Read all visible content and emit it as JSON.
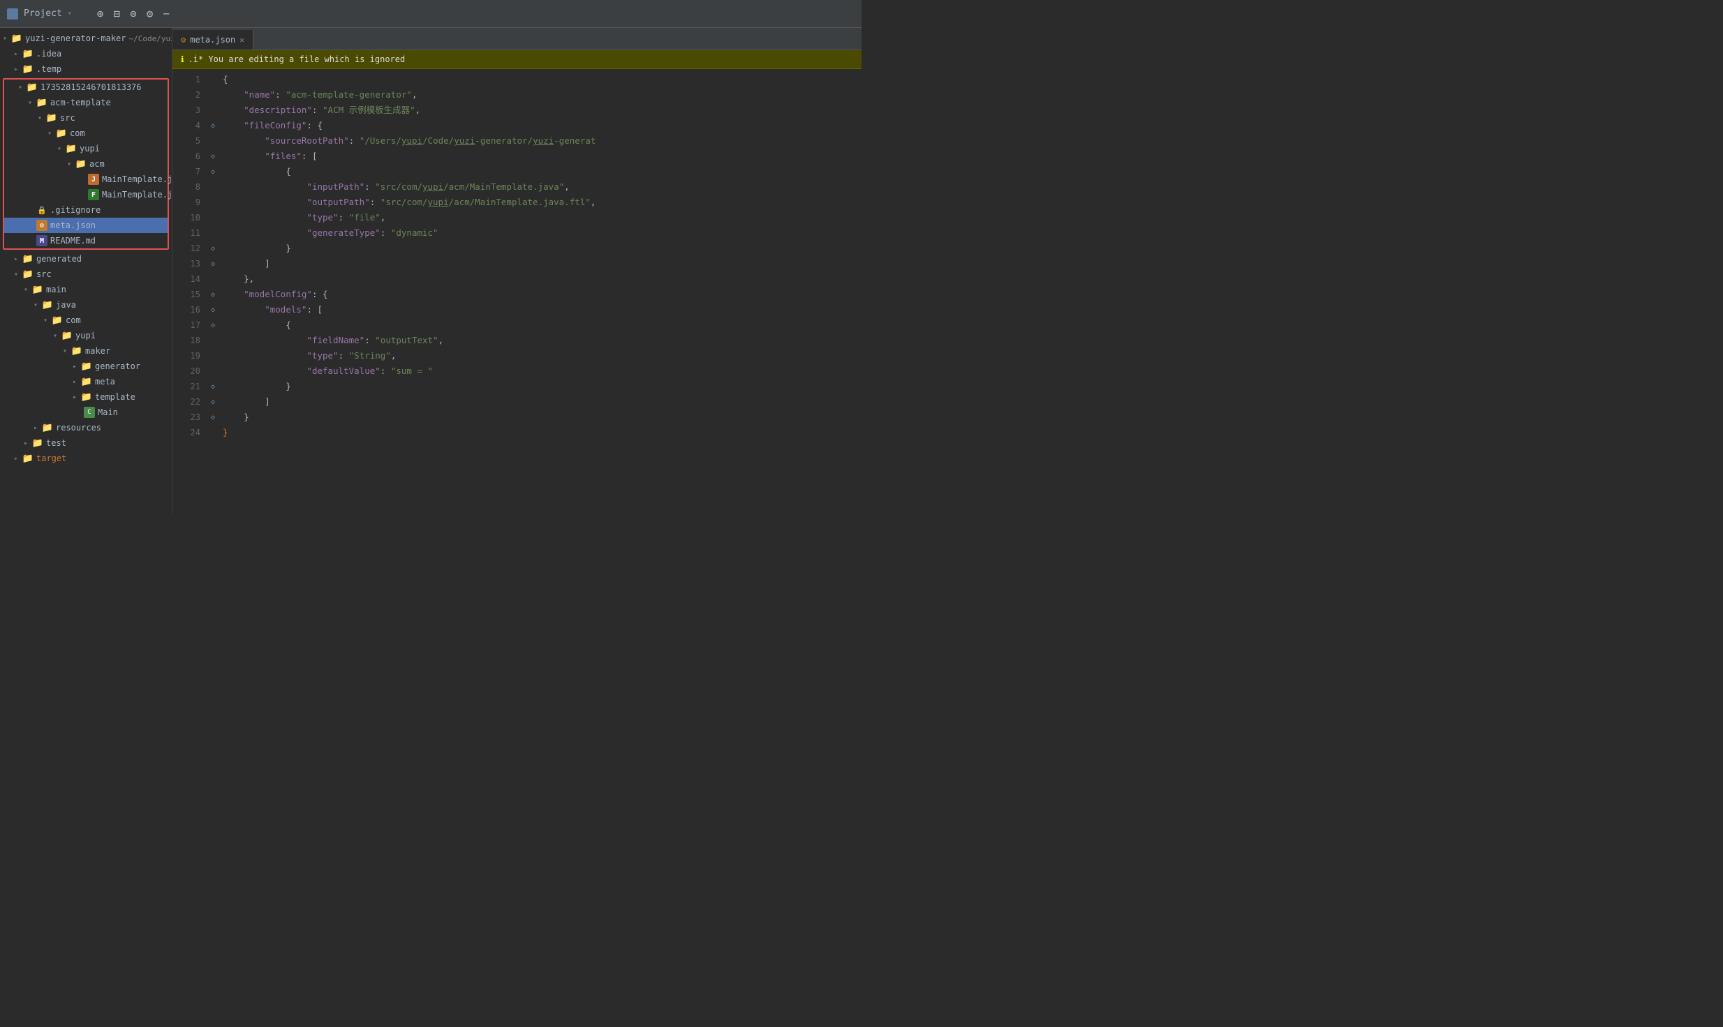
{
  "titleBar": {
    "title": "Project",
    "projectName": "yuzi-generator-maker",
    "projectPath": "~/Code/yuzi-generator/y",
    "icons": [
      "target-icon",
      "layout-icon",
      "filter-icon",
      "settings-icon",
      "minimize-icon"
    ]
  },
  "tabs": [
    {
      "label": "meta.json",
      "active": true,
      "icon": "json-icon"
    }
  ],
  "warningBar": {
    "text": ".i* You are editing a file which is ignored"
  },
  "sidebar": {
    "items": [
      {
        "id": "idea",
        "label": ".idea",
        "type": "folder",
        "depth": 1,
        "open": false,
        "color": "blue"
      },
      {
        "id": "temp",
        "label": ".temp",
        "type": "folder",
        "depth": 1,
        "open": false,
        "color": "gray"
      },
      {
        "id": "temp-id",
        "label": "17352815246701813376",
        "type": "folder",
        "depth": 1,
        "open": true,
        "color": "blue",
        "redBorder": true
      },
      {
        "id": "acm-template",
        "label": "acm-template",
        "type": "folder",
        "depth": 2,
        "open": true,
        "color": "blue"
      },
      {
        "id": "src1",
        "label": "src",
        "type": "folder",
        "depth": 3,
        "open": true,
        "color": "blue"
      },
      {
        "id": "com1",
        "label": "com",
        "type": "folder",
        "depth": 4,
        "open": true,
        "color": "blue"
      },
      {
        "id": "yupi1",
        "label": "yupi",
        "type": "folder",
        "depth": 5,
        "open": true,
        "color": "blue"
      },
      {
        "id": "acm1",
        "label": "acm",
        "type": "folder",
        "depth": 6,
        "open": true,
        "color": "blue"
      },
      {
        "id": "MainTemplate.java",
        "label": "MainTemplate.java",
        "type": "file",
        "depth": 7,
        "fileType": "java"
      },
      {
        "id": "MainTemplate.java.ftl",
        "label": "MainTemplate.java.ftl",
        "type": "file",
        "depth": 7,
        "fileType": "ftl"
      },
      {
        "id": ".gitignore",
        "label": ".gitignore",
        "type": "file",
        "depth": 2,
        "fileType": "gitignore"
      },
      {
        "id": "meta.json",
        "label": "meta.json",
        "type": "file",
        "depth": 2,
        "fileType": "json",
        "selected": true
      },
      {
        "id": "README.md",
        "label": "README.md",
        "type": "file",
        "depth": 2,
        "fileType": "md"
      },
      {
        "id": "generated",
        "label": "generated",
        "type": "folder",
        "depth": 1,
        "open": false,
        "color": "blue"
      },
      {
        "id": "src2",
        "label": "src",
        "type": "folder",
        "depth": 1,
        "open": true,
        "color": "blue"
      },
      {
        "id": "main",
        "label": "main",
        "type": "folder",
        "depth": 2,
        "open": true,
        "color": "blue"
      },
      {
        "id": "java",
        "label": "java",
        "type": "folder",
        "depth": 3,
        "open": true,
        "color": "blue"
      },
      {
        "id": "com2",
        "label": "com",
        "type": "folder",
        "depth": 4,
        "open": true,
        "color": "blue"
      },
      {
        "id": "yupi2",
        "label": "yupi",
        "type": "folder",
        "depth": 5,
        "open": true,
        "color": "blue"
      },
      {
        "id": "maker",
        "label": "maker",
        "type": "folder",
        "depth": 6,
        "open": true,
        "color": "blue"
      },
      {
        "id": "generator",
        "label": "generator",
        "type": "folder",
        "depth": 7,
        "open": false,
        "color": "blue"
      },
      {
        "id": "meta2",
        "label": "meta",
        "type": "folder",
        "depth": 7,
        "open": false,
        "color": "blue"
      },
      {
        "id": "template2",
        "label": "template",
        "type": "folder",
        "depth": 7,
        "open": false,
        "color": "blue"
      },
      {
        "id": "Main",
        "label": "Main",
        "type": "file",
        "depth": 7,
        "fileType": "main-java"
      },
      {
        "id": "resources",
        "label": "resources",
        "type": "folder",
        "depth": 3,
        "open": false,
        "color": "gray"
      },
      {
        "id": "test",
        "label": "test",
        "type": "folder",
        "depth": 2,
        "open": false,
        "color": "blue"
      },
      {
        "id": "target",
        "label": "target",
        "type": "folder",
        "depth": 1,
        "open": false,
        "color": "orange"
      }
    ]
  },
  "editor": {
    "filename": "meta.json",
    "lines": [
      {
        "num": 1,
        "content": "{",
        "gutterDot": false
      },
      {
        "num": 2,
        "content": "    \"name\": \"acm-template-generator\",",
        "gutterDot": false
      },
      {
        "num": 3,
        "content": "    \"description\": \"ACM 示例模板生成器\",",
        "gutterDot": false
      },
      {
        "num": 4,
        "content": "    \"fileConfig\": {",
        "gutterDot": true
      },
      {
        "num": 5,
        "content": "        \"sourceRootPath\": \"/Users/yupi/Code/yuzi-generator/yuzi-generat",
        "gutterDot": false
      },
      {
        "num": 6,
        "content": "        \"files\": [",
        "gutterDot": true
      },
      {
        "num": 7,
        "content": "            {",
        "gutterDot": true
      },
      {
        "num": 8,
        "content": "                \"inputPath\": \"src/com/yupi/acm/MainTemplate.java\",",
        "gutterDot": false
      },
      {
        "num": 9,
        "content": "                \"outputPath\": \"src/com/yupi/acm/MainTemplate.java.ftl\",",
        "gutterDot": false
      },
      {
        "num": 10,
        "content": "                \"type\": \"file\",",
        "gutterDot": false
      },
      {
        "num": 11,
        "content": "                \"generateType\": \"dynamic\"",
        "gutterDot": false
      },
      {
        "num": 12,
        "content": "            }",
        "gutterDot": true
      },
      {
        "num": 13,
        "content": "        ]",
        "gutterDot": true
      },
      {
        "num": 14,
        "content": "    },",
        "gutterDot": false
      },
      {
        "num": 15,
        "content": "    \"modelConfig\": {",
        "gutterDot": true
      },
      {
        "num": 16,
        "content": "        \"models\": [",
        "gutterDot": true
      },
      {
        "num": 17,
        "content": "            {",
        "gutterDot": true
      },
      {
        "num": 18,
        "content": "                \"fieldName\": \"outputText\",",
        "gutterDot": false
      },
      {
        "num": 19,
        "content": "                \"type\": \"String\",",
        "gutterDot": false
      },
      {
        "num": 20,
        "content": "                \"defaultValue\": \"sum = \"",
        "gutterDot": false
      },
      {
        "num": 21,
        "content": "            }",
        "gutterDot": true
      },
      {
        "num": 22,
        "content": "        ]",
        "gutterDot": true
      },
      {
        "num": 23,
        "content": "    }",
        "gutterDot": true
      },
      {
        "num": 24,
        "content": "}",
        "gutterDot": false
      }
    ]
  }
}
